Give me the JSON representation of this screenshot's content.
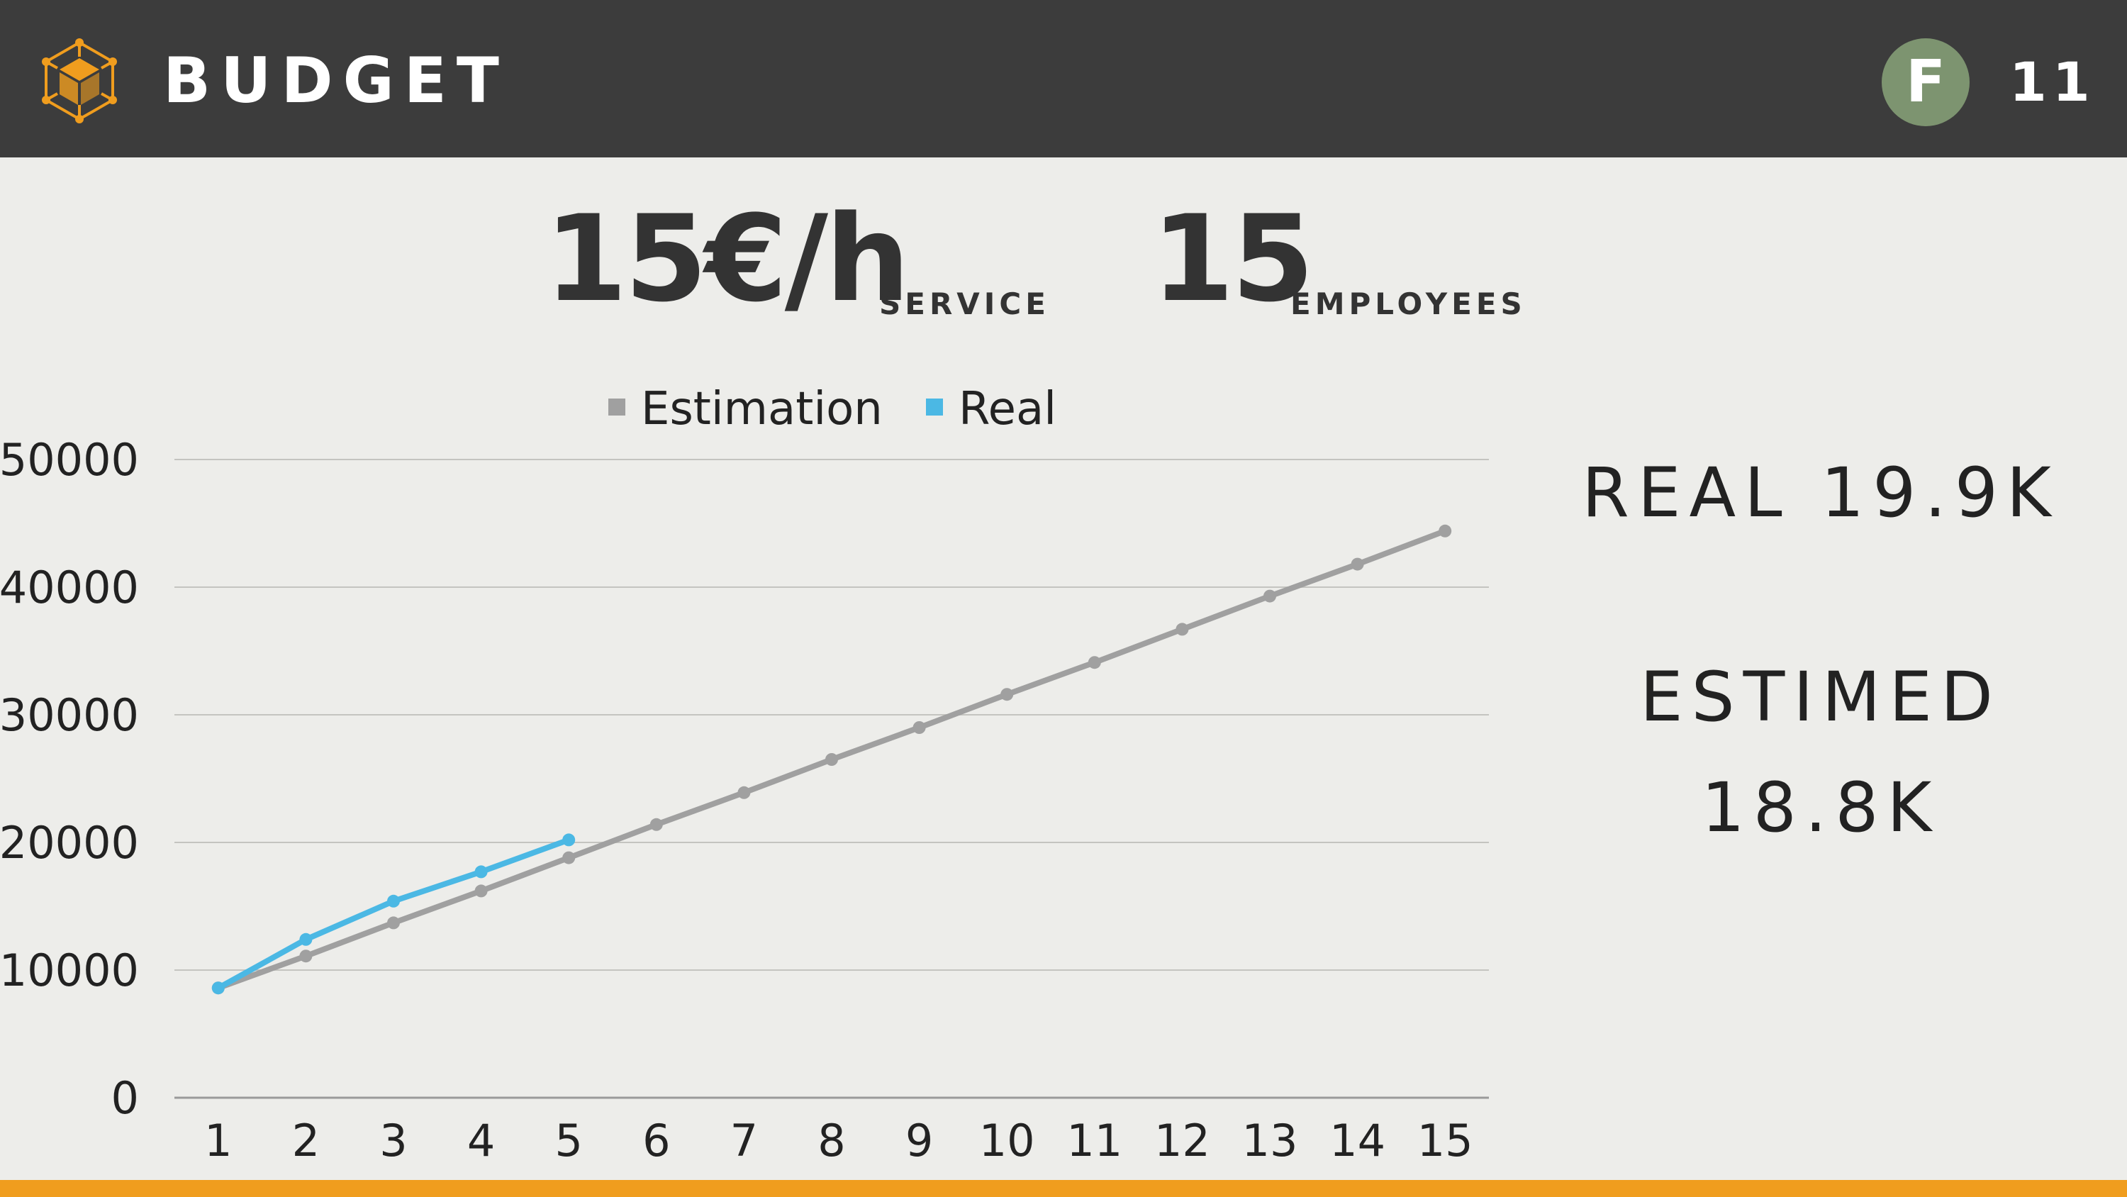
{
  "header": {
    "title": "BUDGET",
    "logo_icon": "cube-network-icon",
    "avatar_letter": "F",
    "page_number": "11"
  },
  "stats": [
    {
      "value": "15€/h",
      "label": "SERVICE"
    },
    {
      "value": "15",
      "label": "EMPLOYEES"
    }
  ],
  "summary": {
    "real": "REAL 19.9K",
    "estimated_label": "ESTIMED",
    "estimated_value": "18.8K"
  },
  "colors": {
    "header_bg": "#3c3c3c",
    "accent": "#f09d1e",
    "avatar": "#7d9470",
    "estimation": "#a0a0a0",
    "real": "#4bb8e4"
  },
  "chart_data": {
    "type": "line",
    "categories": [
      "1",
      "2",
      "3",
      "4",
      "5",
      "6",
      "7",
      "8",
      "9",
      "10",
      "11",
      "12",
      "13",
      "14",
      "15"
    ],
    "series": [
      {
        "name": "Estimation",
        "color": "#a0a0a0",
        "values": [
          8600,
          11100,
          13700,
          16200,
          18800,
          21400,
          23900,
          26500,
          29000,
          31600,
          34100,
          36700,
          39300,
          41800,
          44400
        ]
      },
      {
        "name": "Real",
        "color": "#4bb8e4",
        "values": [
          8600,
          12400,
          15400,
          17700,
          20200
        ]
      }
    ],
    "ylim": [
      0,
      50000
    ],
    "yticks": [
      "0",
      "10000",
      "20000",
      "30000",
      "40000",
      "50000"
    ],
    "grid": true,
    "legend": "top"
  }
}
